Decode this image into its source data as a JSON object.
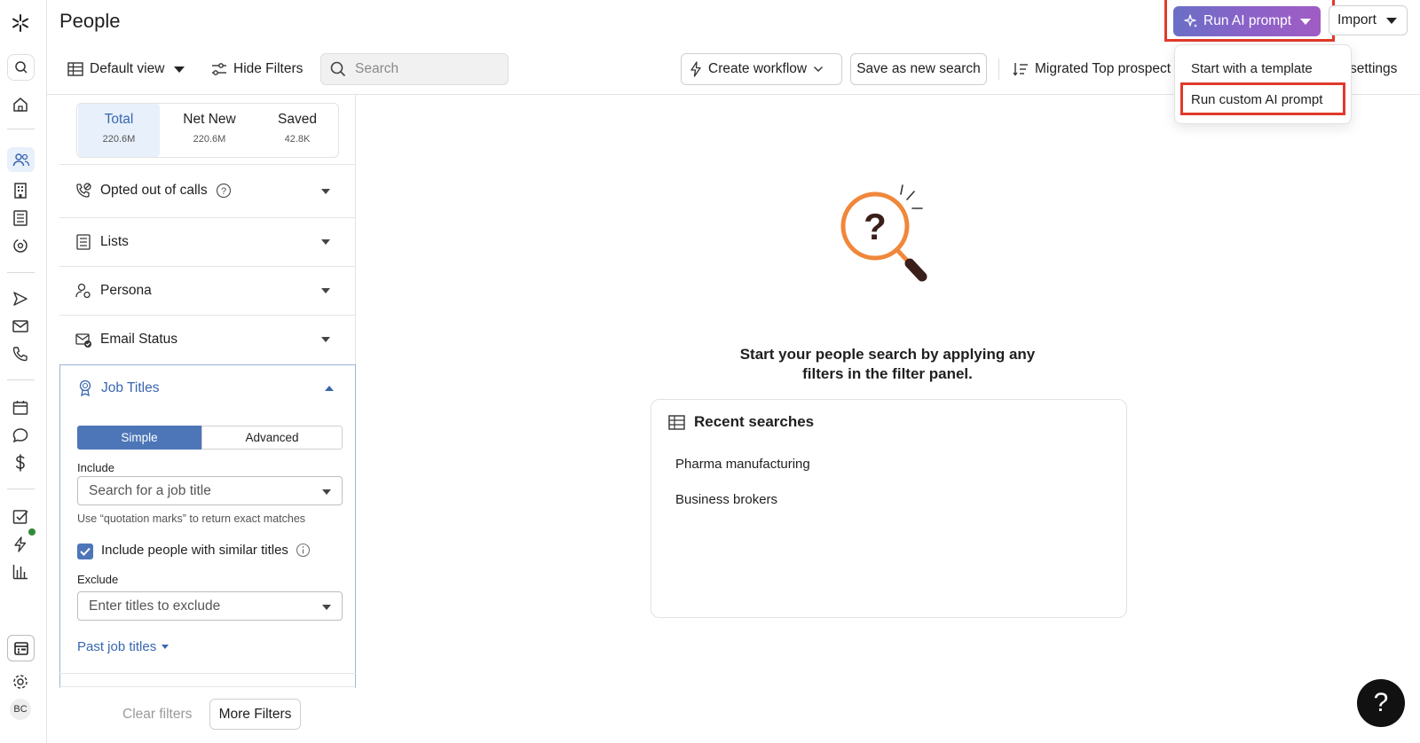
{
  "header": {
    "title": "People",
    "default_view": "Default view",
    "hide_filters": "Hide Filters",
    "search_placeholder": "Search",
    "create_workflow": "Create workflow",
    "save_search": "Save as new search",
    "sort_label": "Migrated Top prospect",
    "settings_fragment": "settings",
    "ai_prompt": "Run AI prompt",
    "import": "Import"
  },
  "ai_menu": {
    "items": [
      "Start with a template",
      "Run custom AI prompt"
    ]
  },
  "counts": {
    "tabs": [
      {
        "label": "Total",
        "value": "220.6M"
      },
      {
        "label": "Net New",
        "value": "220.6M"
      },
      {
        "label": "Saved",
        "value": "42.8K"
      }
    ]
  },
  "filters": {
    "sections": [
      "Opted out of calls",
      "Lists",
      "Persona",
      "Email Status"
    ],
    "job_titles": {
      "title": "Job Titles",
      "mode_simple": "Simple",
      "mode_advanced": "Advanced",
      "include_label": "Include",
      "include_placeholder": "Search for a job title",
      "hint": "Use “quotation marks” to return exact matches",
      "similar_label": "Include people with similar titles",
      "exclude_label": "Exclude",
      "exclude_placeholder": "Enter titles to exclude",
      "past_titles": "Past job titles"
    },
    "clear": "Clear filters",
    "more": "More Filters"
  },
  "empty_state": {
    "message_line1": "Start your people search by applying any",
    "message_line2": "filters in the filter panel.",
    "recent_title": "Recent searches",
    "recent_items": [
      "Pharma manufacturing",
      "Business brokers"
    ]
  },
  "user": {
    "initials": "BC"
  },
  "help": {
    "label": "?"
  },
  "colors": {
    "accent_blue": "#3a66b0",
    "selected_tab_bg": "#e8f0fb",
    "highlight_red": "#e03a2a",
    "illustration_orange": "#f0873a"
  }
}
